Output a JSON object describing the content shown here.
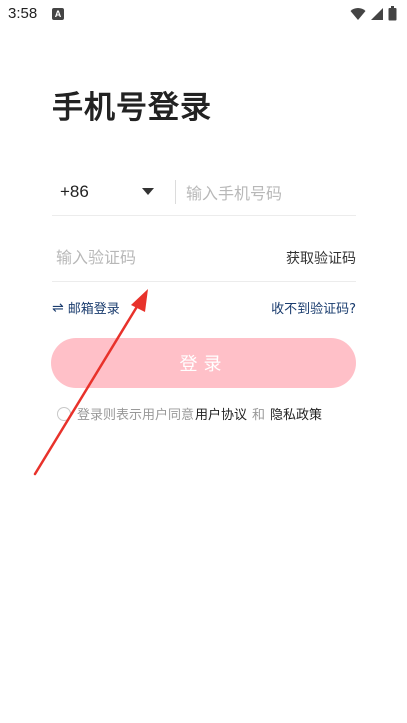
{
  "status_bar": {
    "time": "3:58",
    "notification_icon": "A",
    "icons": [
      "wifi-icon",
      "signal-icon",
      "battery-icon"
    ]
  },
  "title": "手机号登录",
  "phone": {
    "country_code": "+86",
    "placeholder": "输入手机号码",
    "value": ""
  },
  "code": {
    "placeholder": "输入验证码",
    "value": "",
    "get_code_label": "获取验证码"
  },
  "links": {
    "email_login_icon": "⇌",
    "email_login": "邮箱登录",
    "no_code": "收不到验证码?"
  },
  "login_button": "登录",
  "agreement": {
    "prefix": "登录则表示用户同意",
    "user_agreement": "用户协议",
    "and": "和",
    "privacy_policy": "隐私政策"
  },
  "colors": {
    "button": "#ffc0c8",
    "link": "#1a3c6e",
    "annotation_arrow": "#e8322b"
  }
}
